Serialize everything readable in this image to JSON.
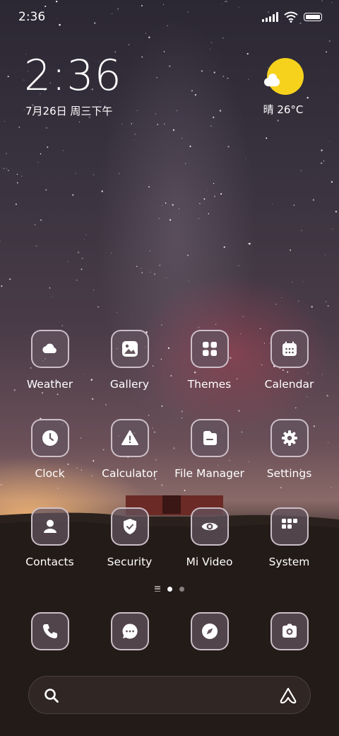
{
  "status_bar": {
    "time": "2:36",
    "signal_icon": "signal-icon",
    "wifi_icon": "wifi-icon",
    "battery_icon": "battery-icon"
  },
  "clock_widget": {
    "time": "2:36",
    "date": "7月26日 周三下午"
  },
  "weather_widget": {
    "icon": "sun-cloud-icon",
    "text": "晴 26°C"
  },
  "apps": [
    {
      "label": "Weather",
      "icon": "weather-icon"
    },
    {
      "label": "Gallery",
      "icon": "gallery-icon"
    },
    {
      "label": "Themes",
      "icon": "themes-icon"
    },
    {
      "label": "Calendar",
      "icon": "calendar-icon"
    },
    {
      "label": "Clock",
      "icon": "clock-icon"
    },
    {
      "label": "Calculator",
      "icon": "calculator-icon"
    },
    {
      "label": "File Manager",
      "icon": "file-manager-icon"
    },
    {
      "label": "Settings",
      "icon": "settings-icon"
    },
    {
      "label": "Contacts",
      "icon": "contacts-icon"
    },
    {
      "label": "Security",
      "icon": "security-icon"
    },
    {
      "label": "Mi Video",
      "icon": "mi-video-icon"
    },
    {
      "label": "System",
      "icon": "system-folder-icon"
    }
  ],
  "pager": {
    "pages": 2,
    "active": 1
  },
  "dock": [
    {
      "icon": "phone-icon"
    },
    {
      "icon": "messages-icon"
    },
    {
      "icon": "browser-icon"
    },
    {
      "icon": "camera-icon"
    }
  ],
  "search_bar": {
    "search_icon": "search-icon",
    "assistant_icon": "assistant-icon"
  },
  "colors": {
    "sun": "#f6d21d",
    "icon_bg": "#64555f",
    "icon_border": "#e1d2dc"
  }
}
